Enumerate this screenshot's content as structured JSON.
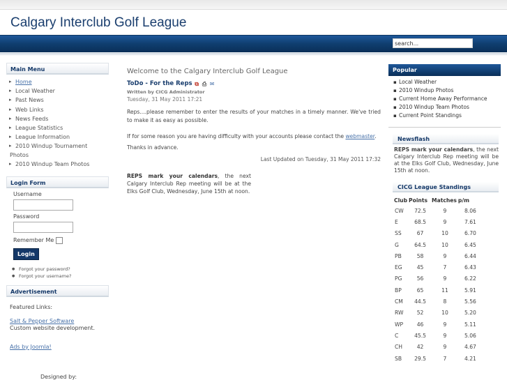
{
  "site": {
    "title": "Calgary Interclub Golf League",
    "search_placeholder": "search..."
  },
  "main_menu": {
    "title": "Main Menu",
    "items": [
      {
        "label": "Home"
      },
      {
        "label": "Local Weather"
      },
      {
        "label": "Past News"
      },
      {
        "label": "Web Links"
      },
      {
        "label": "News Feeds"
      },
      {
        "label": "League Statistics"
      },
      {
        "label": "League Information"
      },
      {
        "label": "2010 Windup Tournament",
        "cont": "Photos"
      },
      {
        "label": "2010 Windup Team Photos"
      }
    ]
  },
  "login_form": {
    "title": "Login Form",
    "username_label": "Username",
    "password_label": "Password",
    "remember_label": "Remember Me",
    "login_button": "Login",
    "links": [
      "Forgot your password?",
      "Forgot your username?"
    ]
  },
  "advertisement": {
    "title": "Advertisement",
    "featured_label": "Featured Links:",
    "sponsor_link": "Salt & Pepper Software",
    "sponsor_desc": "Custom website development.",
    "ads_link": "Ads by Joomla!",
    "designed_by": "Designed by:"
  },
  "article": {
    "welcome": "Welcome to the Calgary Interclub Golf League",
    "title": "ToDo - For the Reps",
    "icons": [
      "pdf-icon",
      "print-icon",
      "email-icon"
    ],
    "byline": "Written by CICG Administrator",
    "date": "Tuesday, 31 May 2011 17:21",
    "para1": "Reps....please remember to enter the results of your matches in a timely manner. We've tried to make it as easy as possible.",
    "para2_prefix": "If for some reason you are having difficulty with your accounts please contact the ",
    "para2_link": "webmaster",
    "para2_suffix": ".",
    "para3": "Thanks in advance.",
    "last_updated": "Last Updated on Tuesday, 31 May 2011 17:32",
    "reps_bold": "REPS mark your calendars",
    "reps_text": ", the next Calgary Interclub Rep meeting will be at the Elks Golf Club, Wednesday, June 15th at noon."
  },
  "popular": {
    "title": "Popular",
    "items": [
      "Local Weather",
      "2010 Windup Photos",
      "Current Home Away Performance",
      "2010 Windup Team Photos",
      "Current Point Standings"
    ]
  },
  "newsflash": {
    "title": "Newsflash",
    "bold": "REPS mark your calendars",
    "text": ", the next Calgary Interclub Rep meeting will be at the Elks Golf Club, Wednesday, June 15th at noon."
  },
  "standings": {
    "title": "CICG League Standings",
    "headers": [
      "Club",
      "Points",
      "Matches",
      "p/m"
    ],
    "rows": [
      [
        "CW",
        "72.5",
        "9",
        "8.06"
      ],
      [
        "E",
        "68.5",
        "9",
        "7.61"
      ],
      [
        "SS",
        "67",
        "10",
        "6.70"
      ],
      [
        "G",
        "64.5",
        "10",
        "6.45"
      ],
      [
        "PB",
        "58",
        "9",
        "6.44"
      ],
      [
        "EG",
        "45",
        "7",
        "6.43"
      ],
      [
        "PG",
        "56",
        "9",
        "6.22"
      ],
      [
        "BP",
        "65",
        "11",
        "5.91"
      ],
      [
        "CM",
        "44.5",
        "8",
        "5.56"
      ],
      [
        "RW",
        "52",
        "10",
        "5.20"
      ],
      [
        "WP",
        "46",
        "9",
        "5.11"
      ],
      [
        "C",
        "45.5",
        "9",
        "5.06"
      ],
      [
        "CH",
        "42",
        "9",
        "4.67"
      ],
      [
        "SB",
        "29.5",
        "7",
        "4.21"
      ]
    ]
  }
}
